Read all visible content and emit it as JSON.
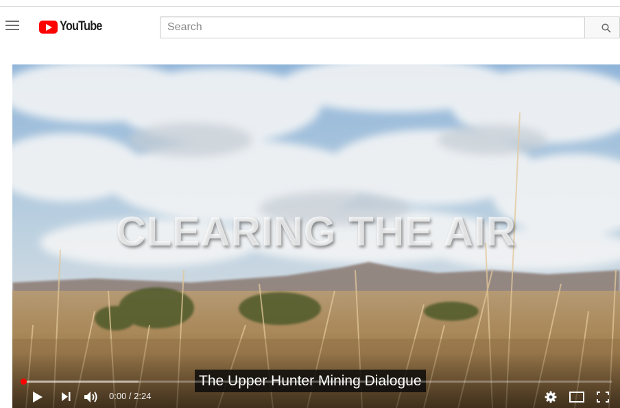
{
  "header": {
    "logo_text": "YouTube",
    "search": {
      "placeholder": "Search",
      "value": ""
    }
  },
  "video": {
    "title_overlay": "CLEARING THE AIR",
    "caption": "The Upper Hunter Mining Dialogue",
    "time": {
      "current": "0:00",
      "separator": " / ",
      "duration": "2:24"
    },
    "progress": {
      "played_fraction": 0.0,
      "buffered_fraction": 0.2
    }
  },
  "colors": {
    "brand": "#ff0000",
    "header_bg": "#ffffff",
    "caption_bg": "#080808"
  },
  "icons": {
    "menu": "hamburger-menu-icon",
    "search": "magnifier-icon",
    "play": "play-icon",
    "next": "next-track-icon",
    "volume": "volume-icon",
    "settings": "gear-icon",
    "theater": "theater-mode-icon",
    "fullscreen": "fullscreen-icon"
  }
}
